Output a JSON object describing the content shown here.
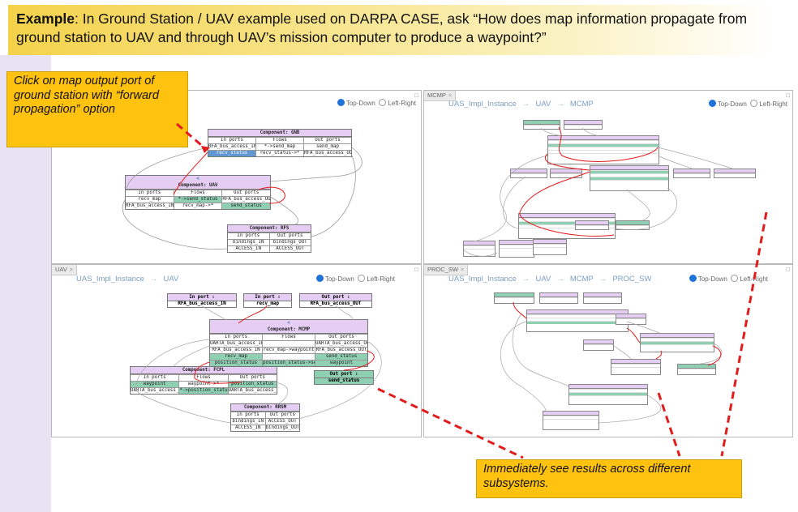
{
  "banner": {
    "bold": "Example",
    "text": ": In Ground Station / UAV example used on DARPA CASE, ask “How does map information propagate from ground station to UAV and through UAV’s mission computer to produce a waypoint?”"
  },
  "callout_top": "Click on map output port of ground station with “forward propagation” option",
  "callout_bottom": "Immediately see results across different subsystems.",
  "layout_options": {
    "top_down": "Top-Down",
    "left_right": "Left-Right"
  },
  "panes": {
    "top_left": {
      "components": {
        "gnd": {
          "title": "Component: GND",
          "headers": [
            "In ports",
            "Flows",
            "Out ports"
          ],
          "rows": [
            [
              "RFA_bus_access_IN",
              "*->send_map",
              "send_map"
            ],
            [
              "recv_status",
              "recv_status->*",
              "RFA_bus_access_OUT"
            ]
          ]
        },
        "uav": {
          "icon": "<",
          "title": "Component: UAV",
          "headers": [
            "In ports",
            "Flows",
            "Out ports"
          ],
          "rows": [
            [
              "recv_map",
              "*->send_status",
              "RFA_bus_access_OUT"
            ],
            [
              "RFA_bus_access_IN",
              "recv_map->*",
              "send_status"
            ]
          ]
        },
        "rfs": {
          "title": "Component: RFS",
          "headers": [
            "In ports",
            "Out ports"
          ],
          "rows": [
            [
              "bindings_IN",
              "bindings_OUT"
            ],
            [
              "ACCESS_IN",
              "ACCESS_OUT"
            ]
          ]
        }
      }
    },
    "top_right": {
      "tab": "MCMP",
      "breadcrumb": [
        "UAS_Impl_Instance",
        "UAV",
        "MCMP"
      ]
    },
    "bottom_left": {
      "tab": "UAV",
      "breadcrumb": [
        "UAS_Impl_Instance",
        "UAV"
      ],
      "ports": {
        "p1": {
          "title": "In port : RFA_bus_access_IN",
          "value": "RFA_bus_access_IN"
        },
        "p2": {
          "title": "In port : recv_map",
          "value": "recv_map"
        },
        "p3": {
          "title": "Out port : RFA_bus_access_OUT",
          "value": "RFA_bus_access_OUT"
        },
        "p4": {
          "title": "Out port : send_status",
          "value": "send_status"
        }
      },
      "components": {
        "mcmp": {
          "icon": "<",
          "title": "Component: MCMP",
          "headers": [
            "In ports",
            "Flows",
            "Out ports"
          ],
          "rows": [
            [
              "UARTA_bus_access_IN",
              "",
              "UARTA_bus_access_OUT"
            ],
            [
              "RFA_bus_access_IN",
              "recv_map->waypoint",
              "RFA_bus_access_OUT"
            ],
            [
              "recv_map",
              "",
              "send_status"
            ],
            [
              "position_status",
              "position_status->send_status",
              "waypoint"
            ]
          ]
        },
        "fcpl": {
          "title": "Component: FCPL",
          "headers": [
            "In ports",
            "Flows",
            "Out ports"
          ],
          "rows": [
            [
              "waypoint",
              "waypoint->*",
              "position_status"
            ],
            [
              "UARTA_bus_access_IN",
              "*->position_status",
              "UARTA_bus_access_OUT"
            ]
          ]
        },
        "rrsm": {
          "title": "Component: RRSM",
          "headers": [
            "In ports",
            "Out ports"
          ],
          "rows": [
            [
              "bindings_IN",
              "ACCESS_OUT"
            ],
            [
              "ACCESS_IN",
              "bindings_OUT"
            ]
          ]
        }
      }
    },
    "bottom_right": {
      "tab": "PROC_SW",
      "breadcrumb": [
        "UAS_Impl_Instance",
        "UAV",
        "MCMP",
        "PROC_SW"
      ]
    }
  }
}
